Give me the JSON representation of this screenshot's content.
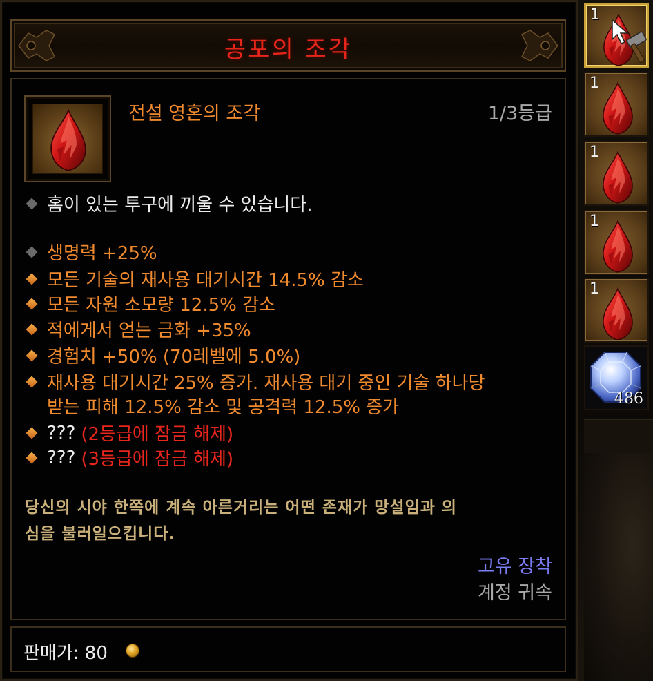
{
  "tooltip": {
    "title": "공포의 조각",
    "item": {
      "name": "전설 영혼의 조각",
      "rank": "1/3등급",
      "icon": "red-soul-shard-icon"
    },
    "socket_line": "홈이 있는 투구에 끼울 수 있습니다.",
    "stats": [
      "생명력 +25%",
      "모든 기술의 재사용 대기시간 14.5% 감소",
      "모든 자원 소모량 12.5% 감소",
      "적에게서 얻는 금화 +35%",
      "경험치 +50% (70레벨에 5.0%)",
      "재사용 대기시간 25% 증가. 재사용 대기 중인 기술 하나당",
      "받는 피해 12.5% 감소 및 공격력 12.5% 증가"
    ],
    "locked": [
      {
        "label": "???",
        "note": "(2등급에 잠금 해제)"
      },
      {
        "label": "???",
        "note": "(3등급에 잠금 해제)"
      }
    ],
    "flavor_line1": "당신의 시야 한쪽에 계속 아른거리는 어떤 존재가 망설임과 의",
    "flavor_line2": "심을 불러일으킵니다.",
    "bind_unique": "고유 장착",
    "bind_account": "계정 귀속",
    "sell_label": "판매가: 80",
    "colors": {
      "title": "#e8251a",
      "legendary": "#f08a2e",
      "locked": "#e8261c",
      "unique": "#7c7cf2",
      "flavor": "#c9b07a"
    }
  },
  "inventory": {
    "slots": [
      {
        "count": "1",
        "icon": "red-soul-shard-icon",
        "selected": true
      },
      {
        "count": "1",
        "icon": "red-soul-shard-icon"
      },
      {
        "count": "1",
        "icon": "red-soul-shard-icon"
      },
      {
        "count": "1",
        "icon": "red-soul-shard-icon"
      },
      {
        "count": "1",
        "icon": "red-soul-shard-icon"
      }
    ],
    "gem": {
      "count": "486",
      "icon": "blue-diamond-gem-icon"
    },
    "cursor_icon": "hammer-cursor-icon"
  }
}
